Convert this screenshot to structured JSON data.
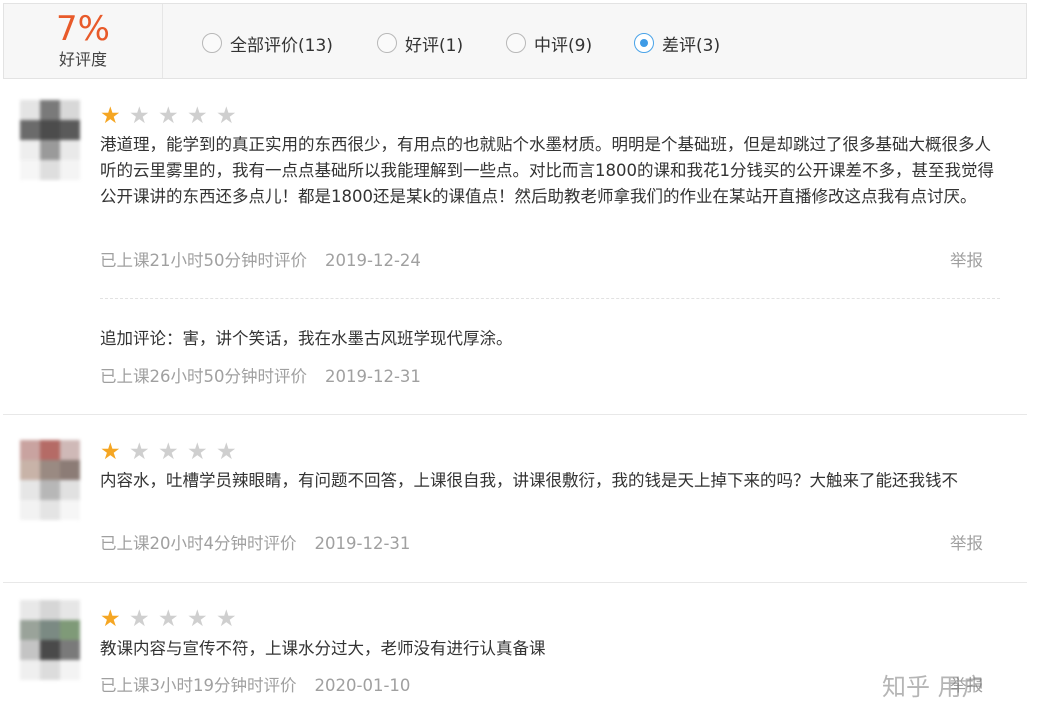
{
  "summary": {
    "percent": "7%",
    "label": "好评度"
  },
  "filters": [
    {
      "label": "全部评价(13)",
      "checked": false
    },
    {
      "label": "好评(1)",
      "checked": false
    },
    {
      "label": "中评(9)",
      "checked": false
    },
    {
      "label": "差评(3)",
      "checked": true
    }
  ],
  "reviews": [
    {
      "rating": 1,
      "text": "港道理，能学到的真正实用的东西很少，有用点的也就贴个水墨材质。明明是个基础班，但是却跳过了很多基础大概很多人听的云里雾里的，我有一点点基础所以我能理解到一些点。对比而言1800的课和我花1分钱买的公开课差不多，甚至我觉得公开课讲的东西还多点儿！都是1800还是某k的课值点！然后助教老师拿我们的作业在某站开直播修改这点我有点讨厌。",
      "meta": "已上课21小时50分钟时评价",
      "date": "2019-12-24",
      "report": "举报",
      "followup": {
        "text": "追加评论：害，讲个笑话，我在水墨古风班学现代厚涂。",
        "meta": "已上课26小时50分钟时评价",
        "date": "2019-12-31"
      }
    },
    {
      "rating": 1,
      "text": "内容水，吐槽学员辣眼睛，有问题不回答，上课很自我，讲课很敷衍，我的钱是天上掉下来的吗？大触来了能还我钱不",
      "meta": "已上课20小时4分钟时评价",
      "date": "2019-12-31",
      "report": "举报"
    },
    {
      "rating": 1,
      "text": "教课内容与宣传不符，上课水分过大，老师没有进行认真备课",
      "meta": "已上课3小时19分钟时评价",
      "date": "2020-01-10",
      "report": "举报"
    }
  ],
  "watermark": "知乎 用户",
  "colors": {
    "accent_orange": "#e85a2a",
    "star_on": "#f5a623",
    "star_off": "#cfcfcf",
    "radio_checked": "#3e9be6"
  }
}
